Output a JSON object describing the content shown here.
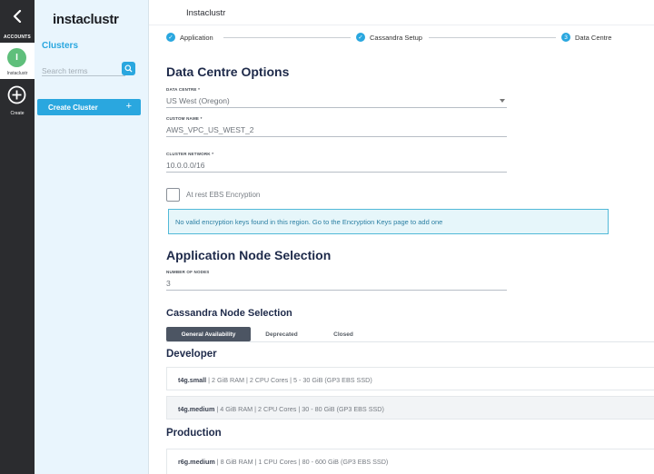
{
  "rail": {
    "accounts_label": "ACCOUNTS",
    "account": {
      "initial": "I",
      "name": "Instaclustr"
    },
    "create_label": "Create"
  },
  "sidebar": {
    "logo": "instaclustr",
    "clusters_title": "Clusters",
    "search_placeholder": "Search terms",
    "create_cluster_label": "Create Cluster",
    "create_cluster_plus": "+"
  },
  "header": {
    "title": "Instaclustr"
  },
  "stepper": {
    "steps": [
      {
        "label": "Application",
        "badge": "✓",
        "state": "done"
      },
      {
        "label": "Cassandra Setup",
        "badge": "✓",
        "state": "done"
      },
      {
        "label": "Data Centre",
        "badge": "3",
        "state": "current"
      }
    ]
  },
  "form": {
    "dc_title": "Data Centre Options",
    "data_centre": {
      "label": "DATA CENTRE *",
      "value": "US West (Oregon)"
    },
    "custom_name": {
      "label": "CUSTOM NAME *",
      "value": "AWS_VPC_US_WEST_2"
    },
    "cluster_network": {
      "label": "CLUSTER NETWORK *",
      "value": "10.0.0.0/16"
    },
    "ebs": {
      "label": "At rest EBS Encryption",
      "checked": false,
      "notice": "No valid encryption keys found in this region. Go to the Encryption Keys page to add one"
    },
    "app_title": "Application Node Selection",
    "number_of_nodes": {
      "label": "NUMBER OF NODES",
      "value": "3"
    },
    "cass_title": "Cassandra Node Selection",
    "tabs": [
      "General Availability",
      "Deprecated",
      "Closed"
    ],
    "active_tab": "General Availability",
    "developer_title": "Developer",
    "developer_nodes": [
      {
        "name": "t4g.small",
        "specs": "| 2 GiB RAM | 2 CPU Cores | 5 - 30 GiB (GP3 EBS SSD)"
      },
      {
        "name": "t4g.medium",
        "specs": "| 4 GiB RAM | 2 CPU Cores | 30 - 80 GiB (GP3 EBS SSD)"
      }
    ],
    "production_title": "Production",
    "production_nodes": [
      {
        "name": "r6g.medium",
        "specs": "| 8 GiB RAM | 1 CPU Cores | 80 - 600 GiB (GP3 EBS SSD)"
      }
    ]
  },
  "colors": {
    "accent": "#2aa7df",
    "rail": "#2b2c2f",
    "sidebar": "#e9f5fd",
    "heading": "#1e2a4a",
    "avatar": "#5fbf7b"
  }
}
